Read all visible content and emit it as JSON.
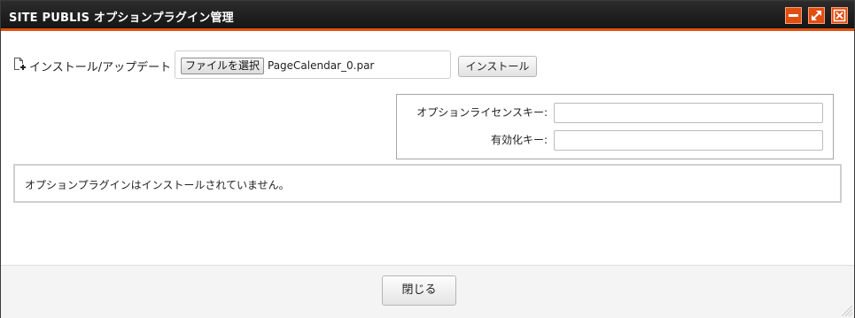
{
  "window": {
    "title": "SITE PUBLIS オプションプラグイン管理",
    "controls": {
      "minimize_icon": "minimize-icon",
      "maximize_icon": "maximize-icon",
      "close_icon": "close-icon"
    }
  },
  "install": {
    "label": "インストール/アップデート",
    "icon": "document-add-icon",
    "file_button_label": "ファイルを選択",
    "file_name": "PageCalendar_0.par",
    "install_button_label": "インストール"
  },
  "license": {
    "option_key_label": "オプションライセンスキー:",
    "option_key_value": "",
    "activation_key_label": "有効化キー:",
    "activation_key_value": ""
  },
  "message": {
    "text": "オプションプラグインはインストールされていません。"
  },
  "footer": {
    "close_button_label": "閉じる"
  },
  "colors": {
    "accent": "#e0510f",
    "titlebar": "#1e1e1e"
  }
}
